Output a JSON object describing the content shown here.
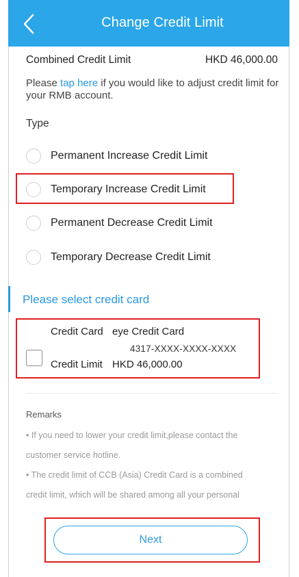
{
  "header": {
    "title": "Change Credit Limit",
    "back_icon": "chevron-left-icon"
  },
  "combined": {
    "label": "Combined Credit Limit",
    "value": "HKD 46,000.00"
  },
  "hint": {
    "prefix": "Please ",
    "link": "tap here",
    "suffix": " if you would like to adjust credit limit for your RMB account."
  },
  "type_label": "Type",
  "types": [
    {
      "label": "Permanent Increase Credit Limit",
      "selected": false
    },
    {
      "label": "Temporary Increase Credit Limit",
      "selected": false
    },
    {
      "label": "Permanent Decrease Credit Limit",
      "selected": false
    },
    {
      "label": "Temporary Decrease Credit Limit",
      "selected": false
    }
  ],
  "section_title": "Please select credit card",
  "card": {
    "card_label": "Credit Card",
    "card_name": "eye Credit Card",
    "card_number": "4317-XXXX-XXXX-XXXX",
    "limit_label": "Credit Limit",
    "limit_value": "HKD 46,000.00",
    "checked": false
  },
  "remarks": {
    "title": "Remarks",
    "lines": [
      "• If you need to lower your credit limit,please contact the",
      "customer service hotline.",
      "• The credit limit of CCB (Asia) Credit Card is a combined",
      "credit limit, which will be shared among all your personal"
    ]
  },
  "next_label": "Next",
  "colors": {
    "header": "#2ba6e8",
    "accent": "#2b98e0",
    "highlight": "#e01f1f"
  }
}
